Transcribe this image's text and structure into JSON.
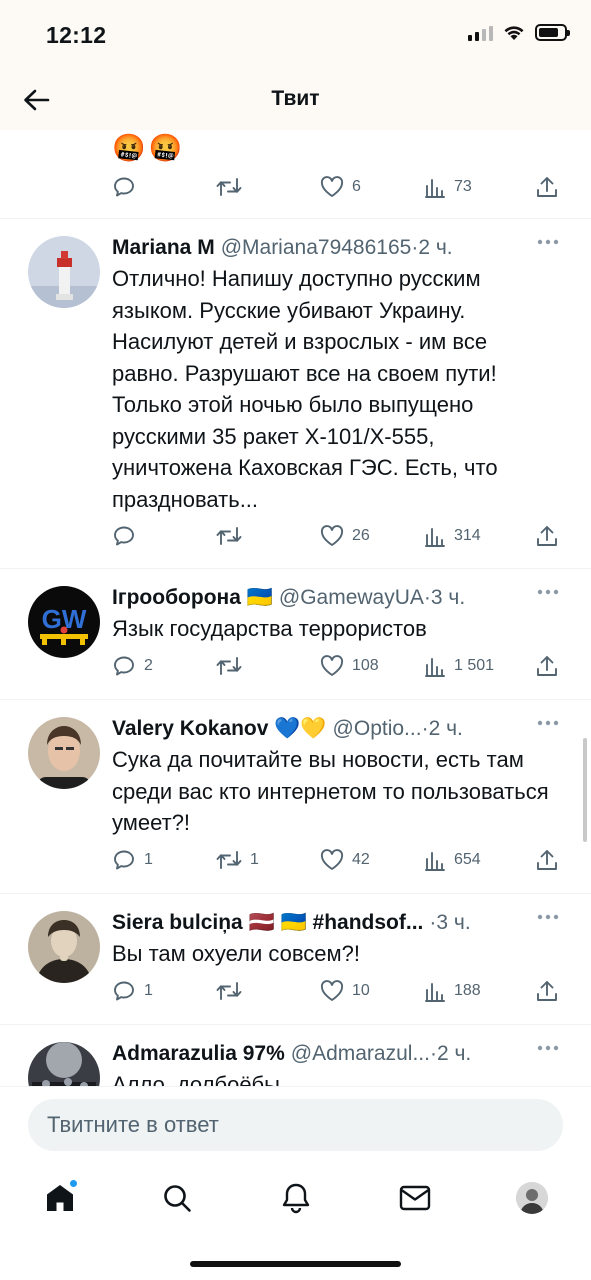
{
  "status_bar": {
    "time": "12:12"
  },
  "header": {
    "title": "Твит"
  },
  "top_tweet": {
    "emojis": "🤬🤬",
    "actions": {
      "replies": "",
      "retweets": "",
      "likes": "6",
      "views": "73"
    }
  },
  "tweets": [
    {
      "author": "Mariana M",
      "handle": "@Mariana79486165",
      "separator": "·",
      "time": "2 ч.",
      "text": "Отлично! Напишу доступно русским языком. Русские убивают Украину. Насилуют детей и взрослых - им все равно. Разрушают все на своем пути! Только этой ночью было выпущено русскими 35 ракет Х-101/Х-555, уничтожена Каховская ГЭС. Есть, что праздновать...",
      "actions": {
        "replies": "",
        "retweets": "",
        "likes": "26",
        "views": "314"
      }
    },
    {
      "author": "Ігрооборона 🇺🇦",
      "handle": "@GamewayUA",
      "separator": "·",
      "time": "3 ч.",
      "text": "Язык государства террористов",
      "actions": {
        "replies": "2",
        "retweets": "",
        "likes": "108",
        "views": "1 501"
      }
    },
    {
      "author": "Valery Kokanov 💙💛",
      "handle": "@Optio...",
      "separator": "·",
      "time": "2 ч.",
      "text": "Сука да почитайте вы новости, есть там среди вас кто интернетом то пользоваться умеет?!",
      "actions": {
        "replies": "1",
        "retweets": "1",
        "likes": "42",
        "views": "654"
      }
    },
    {
      "author": "Siera bulciņa 🇱🇻 🇺🇦 #handsof...",
      "handle": "",
      "separator": "·",
      "time": "3 ч.",
      "text": "Вы там охуели совсем?!",
      "actions": {
        "replies": "1",
        "retweets": "",
        "likes": "10",
        "views": "188"
      }
    },
    {
      "author": "Admarazulia 97%",
      "handle": "@Admarazul...",
      "separator": "·",
      "time": "2 ч.",
      "text": "Алло, долбоёбы",
      "actions": {
        "replies": "",
        "retweets": "",
        "likes": "",
        "views": ""
      }
    }
  ],
  "reply": {
    "placeholder": "Твитните в ответ"
  },
  "nav": {
    "items": [
      "home-icon",
      "search-icon",
      "bell-icon",
      "mail-icon",
      "profile-avatar"
    ]
  },
  "colors": {
    "accent": "#1d9bf0",
    "secondary_text": "#536471",
    "status_bg": "#fdf9f4"
  }
}
